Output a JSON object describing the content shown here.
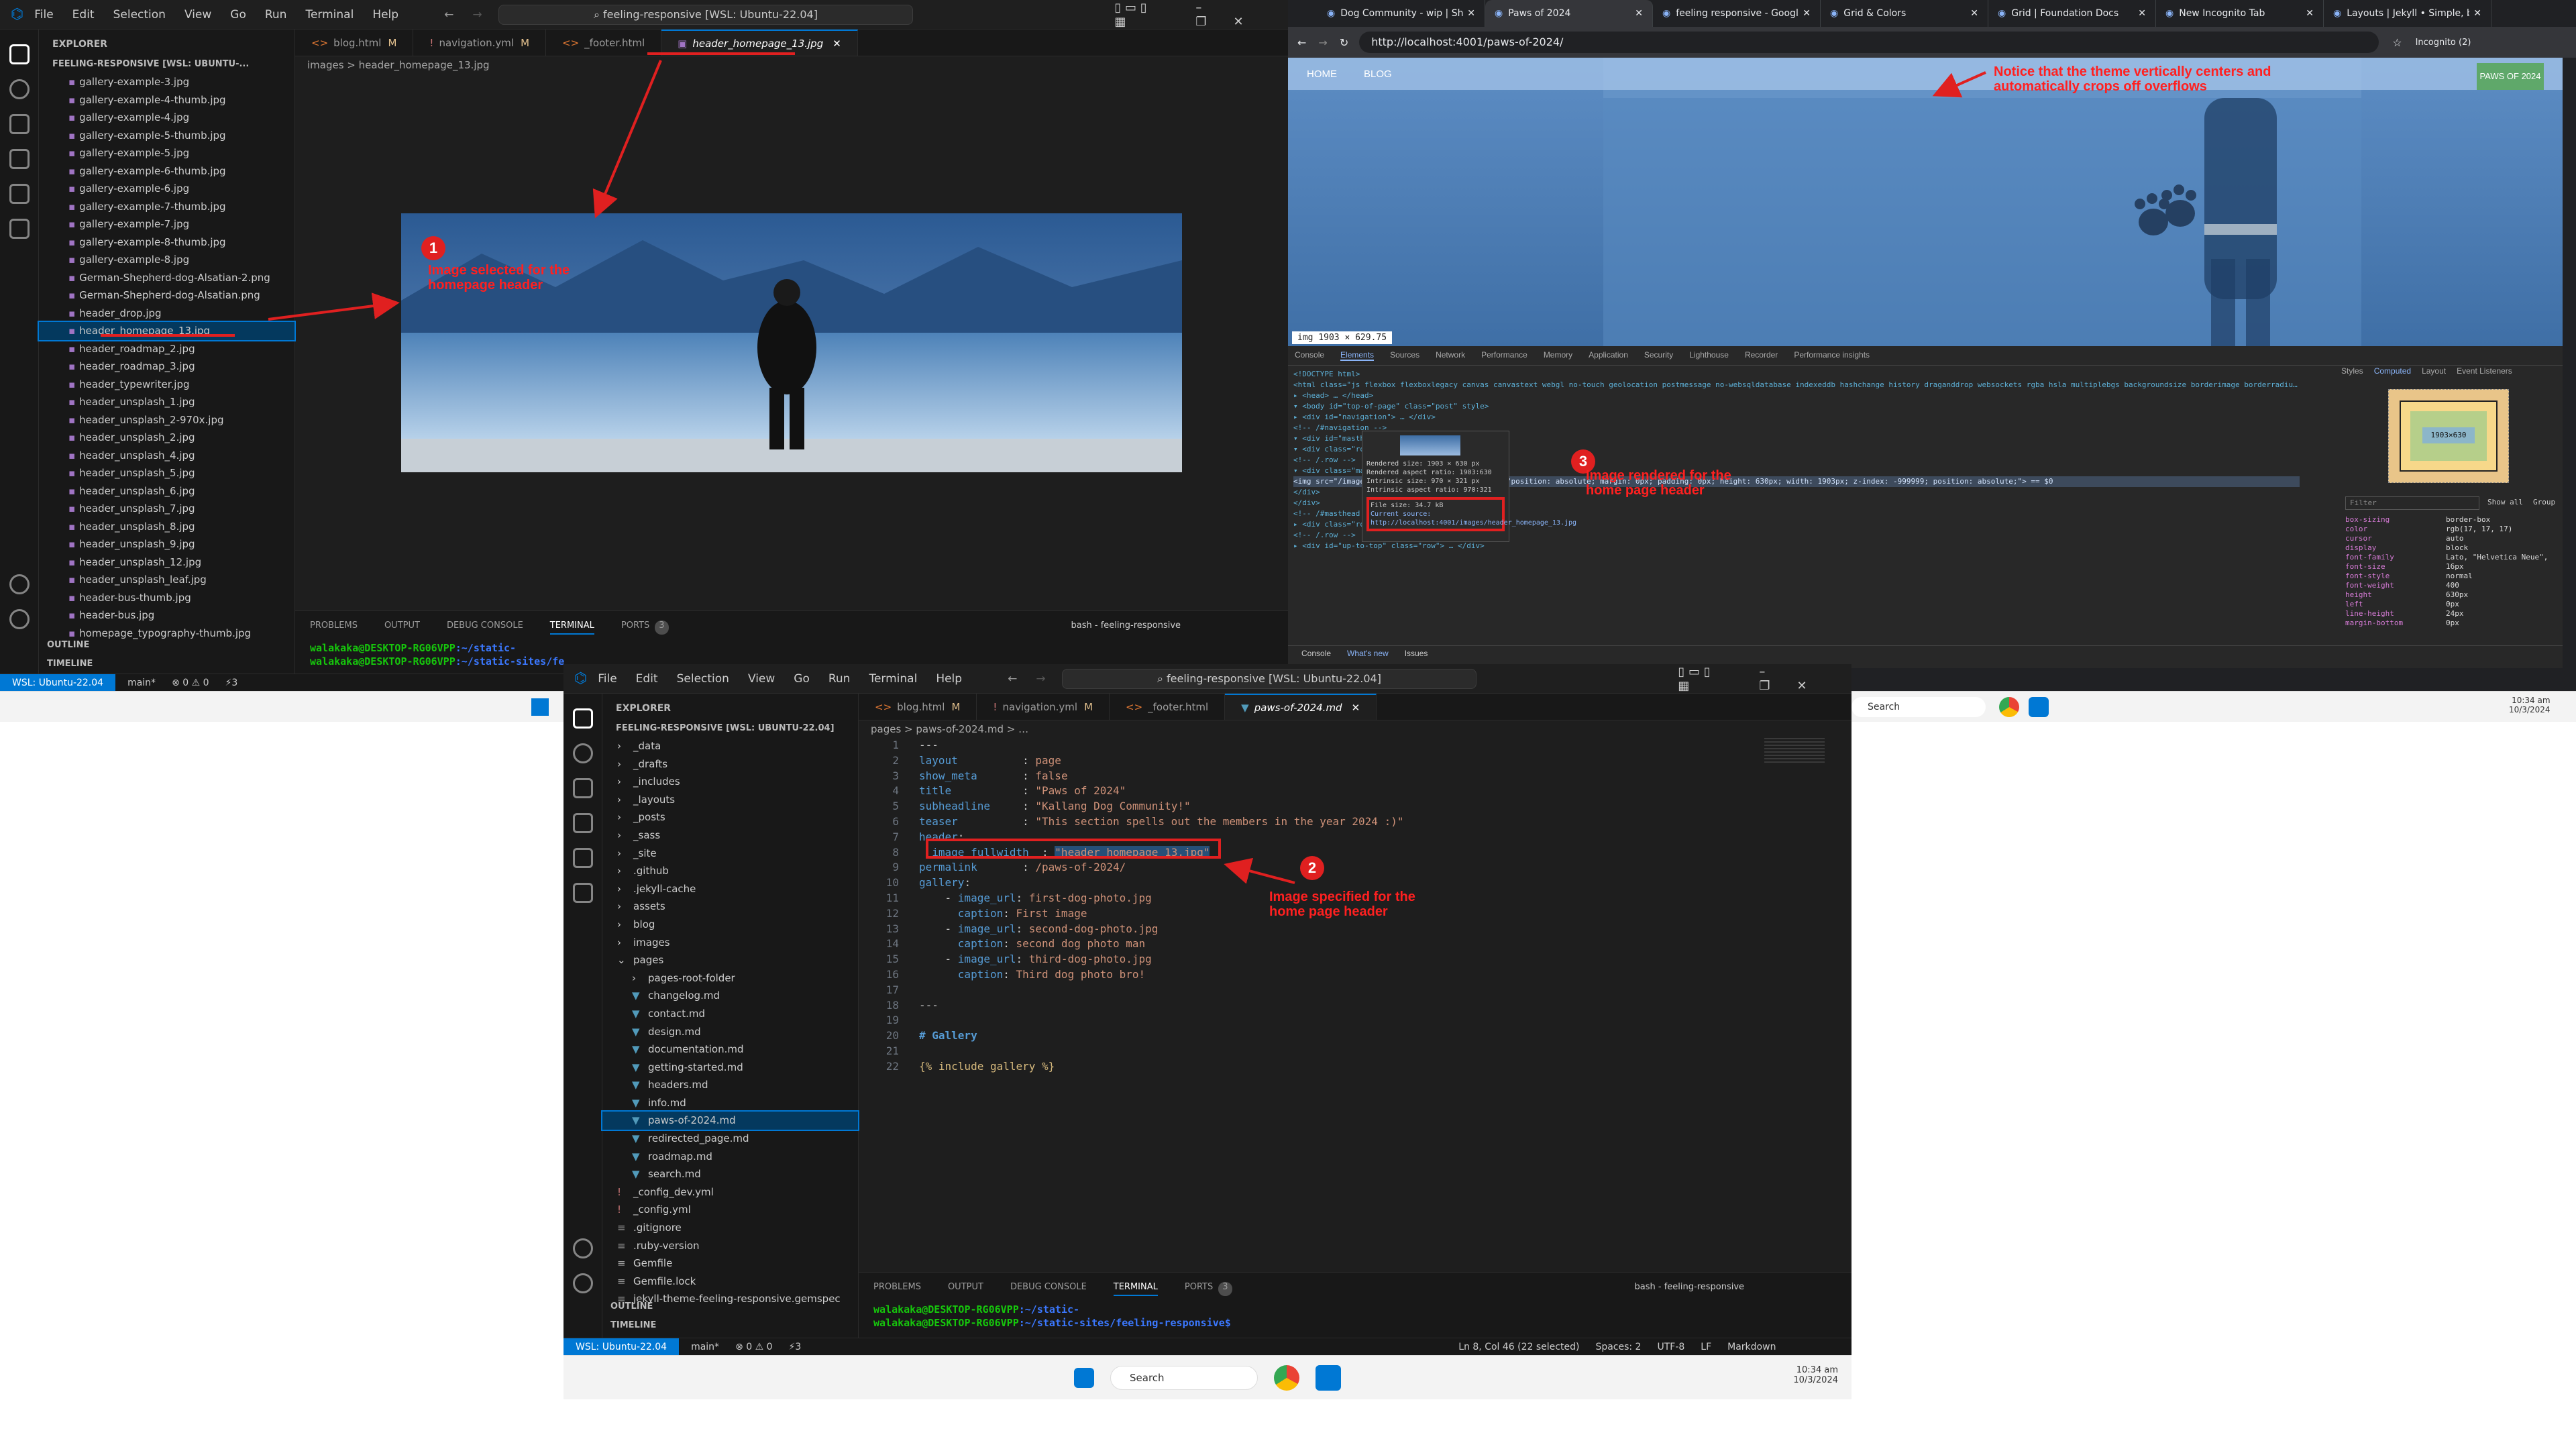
{
  "colors": {
    "accent": "#0078d4",
    "annotation": "#e02020",
    "sky": "#8fa7c7",
    "sea": "#5f8fbd",
    "page_header": "#4f7fb8"
  },
  "vscode_top": {
    "menu": [
      "File",
      "Edit",
      "Selection",
      "View",
      "Go",
      "Run",
      "Terminal",
      "Help"
    ],
    "command_center": "feeling-responsive [WSL: Ubuntu-22.04]",
    "explorer_title": "EXPLORER",
    "workspace": "FEELING-RESPONSIVE [WSL: UBUNTU-...",
    "files": [
      "gallery-example-3.jpg",
      "gallery-example-4-thumb.jpg",
      "gallery-example-4.jpg",
      "gallery-example-5-thumb.jpg",
      "gallery-example-5.jpg",
      "gallery-example-6-thumb.jpg",
      "gallery-example-6.jpg",
      "gallery-example-7-thumb.jpg",
      "gallery-example-7.jpg",
      "gallery-example-8-thumb.jpg",
      "gallery-example-8.jpg",
      "German-Shepherd-dog-Alsatian-2.png",
      "German-Shepherd-dog-Alsatian.png",
      "header_drop.jpg",
      "header_homepage_13.jpg",
      "header_roadmap_2.jpg",
      "header_roadmap_3.jpg",
      "header_typewriter.jpg",
      "header_unsplash_1.jpg",
      "header_unsplash_2-970x.jpg",
      "header_unsplash_2.jpg",
      "header_unsplash_4.jpg",
      "header_unsplash_5.jpg",
      "header_unsplash_6.jpg",
      "header_unsplash_7.jpg",
      "header_unsplash_8.jpg",
      "header_unsplash_9.jpg",
      "header_unsplash_12.jpg",
      "header_unsplash_leaf.jpg",
      "header-bus-thumb.jpg",
      "header-bus.jpg",
      "homepage_typography-thumb.jpg"
    ],
    "outline": "OUTLINE",
    "timeline": "TIMELINE",
    "tabs": [
      {
        "label": "blog.html",
        "mod": "M"
      },
      {
        "label": "navigation.yml",
        "mod": "M"
      },
      {
        "label": "_footer.html",
        "mod": ""
      },
      {
        "label": "header_homepage_13.jpg",
        "mod": ""
      }
    ],
    "breadcrumb": "images > header_homepage_13.jpg",
    "panel_tabs": [
      "PROBLEMS",
      "OUTPUT",
      "DEBUG CONSOLE",
      "TERMINAL",
      "PORTS"
    ],
    "ports_count": "3",
    "terminal_label": "bash - feeling-responsive",
    "terminal_lines": [
      {
        "user": "walakaka@DESKTOP-RG06VPP",
        "path": ":~/static-"
      },
      {
        "user": "walakaka@DESKTOP-RG06VPP",
        "path": ":~/static-sites/fe"
      }
    ],
    "status": {
      "remote": "WSL: Ubuntu-22.04",
      "branch": "main*",
      "problems": "⊗ 0 ⚠ 0",
      "ports": "⚡3"
    }
  },
  "annotations": {
    "one": {
      "num": "1",
      "text": "Image selected for the homepage header"
    },
    "two": {
      "num": "2",
      "text": "Image specified for the home page header"
    },
    "three": {
      "num": "3",
      "text": "Image rendered for the home page header"
    },
    "notice": "Notice that the theme vertically centers and automatically crops off overflows"
  },
  "browser": {
    "tabs": [
      "Dog Community - wip | Shaffo",
      "Paws of 2024",
      "feeling responsive - Google Se",
      "Grid & Colors",
      "Grid | Foundation Docs",
      "New Incognito Tab",
      "Layouts | Jekyll • Simple, blog"
    ],
    "url": "http://localhost:4001/paws-of-2024/",
    "incognito": "Incognito (2)",
    "nav": [
      "HOME",
      "BLOG"
    ],
    "page_badge": "PAWS OF 2024",
    "img_tooltip": "img 1903 × 629.75",
    "devtools_tabs": [
      "Console",
      "Elements",
      "Sources",
      "Network",
      "Performance",
      "Memory",
      "Application",
      "Security",
      "Lighthouse",
      "Recorder",
      "Performance insights"
    ],
    "styles_tabs": [
      "Styles",
      "Computed",
      "Layout",
      "Event Listeners"
    ],
    "info": {
      "rendered_size": "Rendered size: 1903 × 630 px",
      "rendered_ratio": "Rendered aspect ratio: 1903∶630",
      "intrinsic": "Intrinsic size: 970 × 321 px",
      "intrinsic_ratio": "Intrinsic aspect ratio: 970∶321",
      "file_size": "File size: 34.7 kB",
      "source": "Current source: http://localhost:4001/images/header_homepage_13.jpg"
    },
    "html_lines": [
      "<!DOCTYPE html>",
      "<html class=\"js flexbox flexboxlegacy canvas canvastext webgl no-touch geolocation postmessage no-websqldatabase indexeddb hashchange history draganddrop websockets rgba hsla multiplebgs backgroundsize borderimage borderradius boxshadow textshadow opacity cssanimations csscolumns cssgradients cssreflections csstransforms csstransforms3d csstransitions fontface generatedcontent video audio localstorage sessionstorage webworkers no-applicationcache svg inlinesvg smil svgclippaths\" lang=\"en\" style>",
      "▸ <head> … </head>",
      "▾ <body id=\"top-of-page\" class=\"post\" style>",
      "  ▸ <div id=\"navigation\"> … </div>",
      "  <!-- /#navigation -->",
      "  ▾ <div id=\"masthead\">",
      "    ▾ <div class=\"row\">",
      "      <!-- /.row -->",
      "    ▾ <div class=\"masthead-image\">",
      "      <img src=\"/images/header_homepage_13.jpg\" style=\"position: absolute; margin: 0px; padding: 0px; height: 630px; width: 1903px; z-index: -999999; position: absolute;\"> == $0",
      "    </div>",
      "  </div>",
      "  <!-- /#masthead -->",
      "  ▸ <div class=\"row t30\"> … </div>",
      "  <!-- /.row -->",
      "  ▸ <div id=\"up-to-top\" class=\"row\"> … </div>"
    ],
    "console_tabs": [
      "Console",
      "What's new",
      "Issues"
    ],
    "props": [
      {
        "k": "box-sizing",
        "v": "border-box"
      },
      {
        "k": "color",
        "v": "rgb(17, 17, 17)"
      },
      {
        "k": "cursor",
        "v": "auto"
      },
      {
        "k": "display",
        "v": "block"
      },
      {
        "k": "font-family",
        "v": "Lato, \"Helvetica Neue\","
      },
      {
        "k": "font-size",
        "v": "16px"
      },
      {
        "k": "font-style",
        "v": "normal"
      },
      {
        "k": "font-weight",
        "v": "400"
      },
      {
        "k": "height",
        "v": "630px"
      },
      {
        "k": "left",
        "v": "0px"
      },
      {
        "k": "line-height",
        "v": "24px"
      },
      {
        "k": "margin-bottom",
        "v": "0px"
      }
    ],
    "box_model": "1903×630",
    "filter_placeholder": "Filter",
    "show_all": "Show all",
    "group": "Group",
    "taskbar_search": "Search",
    "clock": "10:34 am",
    "date": "10/3/2024"
  },
  "vscode_bottom": {
    "menu": [
      "File",
      "Edit",
      "Selection",
      "View",
      "Go",
      "Run",
      "Terminal",
      "Help"
    ],
    "command_center": "feeling-responsive [WSL: Ubuntu-22.04]",
    "explorer_title": "EXPLORER",
    "workspace": "FEELING-RESPONSIVE [WSL: UBUNTU-22.04]",
    "tree": [
      {
        "label": "_data",
        "type": "dir",
        "depth": 0
      },
      {
        "label": "_drafts",
        "type": "dir",
        "depth": 0
      },
      {
        "label": "_includes",
        "type": "dir",
        "depth": 0
      },
      {
        "label": "_layouts",
        "type": "dir",
        "depth": 0
      },
      {
        "label": "_posts",
        "type": "dir",
        "depth": 0
      },
      {
        "label": "_sass",
        "type": "dir",
        "depth": 0
      },
      {
        "label": "_site",
        "type": "dir",
        "depth": 0
      },
      {
        "label": ".github",
        "type": "dir",
        "depth": 0
      },
      {
        "label": ".jekyll-cache",
        "type": "dir",
        "depth": 0
      },
      {
        "label": "assets",
        "type": "dir",
        "depth": 0
      },
      {
        "label": "blog",
        "type": "dir",
        "depth": 0
      },
      {
        "label": "images",
        "type": "dir",
        "depth": 0
      },
      {
        "label": "pages",
        "type": "open",
        "depth": 0
      },
      {
        "label": "pages-root-folder",
        "type": "dir",
        "depth": 1
      },
      {
        "label": "changelog.md",
        "type": "md",
        "depth": 1
      },
      {
        "label": "contact.md",
        "type": "md",
        "depth": 1
      },
      {
        "label": "design.md",
        "type": "md",
        "depth": 1
      },
      {
        "label": "documentation.md",
        "type": "md",
        "depth": 1
      },
      {
        "label": "getting-started.md",
        "type": "md",
        "depth": 1
      },
      {
        "label": "headers.md",
        "type": "md",
        "depth": 1
      },
      {
        "label": "info.md",
        "type": "md",
        "depth": 1
      },
      {
        "label": "paws-of-2024.md",
        "type": "md",
        "depth": 1,
        "sel": true
      },
      {
        "label": "redirected_page.md",
        "type": "md",
        "depth": 1
      },
      {
        "label": "roadmap.md",
        "type": "md",
        "depth": 1
      },
      {
        "label": "search.md",
        "type": "md",
        "depth": 1
      },
      {
        "label": "_config_dev.yml",
        "type": "yml",
        "depth": 0
      },
      {
        "label": "_config.yml",
        "type": "yml",
        "depth": 0
      },
      {
        "label": ".gitignore",
        "type": "file",
        "depth": 0
      },
      {
        "label": ".ruby-version",
        "type": "file",
        "depth": 0
      },
      {
        "label": "Gemfile",
        "type": "file",
        "depth": 0
      },
      {
        "label": "Gemfile.lock",
        "type": "file",
        "depth": 0
      },
      {
        "label": "jekyll-theme-feeling-responsive.gemspec",
        "type": "file",
        "depth": 0
      }
    ],
    "outline": "OUTLINE",
    "timeline": "TIMELINE",
    "tabs": [
      {
        "label": "blog.html",
        "mod": "M"
      },
      {
        "label": "navigation.yml",
        "mod": "M"
      },
      {
        "label": "_footer.html",
        "mod": ""
      },
      {
        "label": "paws-of-2024.md",
        "mod": ""
      }
    ],
    "breadcrumb": "pages > paws-of-2024.md > …",
    "code": [
      {
        "n": "1",
        "parts": [
          [
            "p",
            "---"
          ]
        ]
      },
      {
        "n": "2",
        "parts": [
          [
            "k",
            "layout"
          ],
          [
            "p",
            "          : "
          ],
          [
            "s",
            "page"
          ]
        ]
      },
      {
        "n": "3",
        "parts": [
          [
            "k",
            "show_meta"
          ],
          [
            "p",
            "       : "
          ],
          [
            "s",
            "false"
          ]
        ]
      },
      {
        "n": "4",
        "parts": [
          [
            "k",
            "title"
          ],
          [
            "p",
            "           : "
          ],
          [
            "s",
            "\"Paws of 2024\""
          ]
        ]
      },
      {
        "n": "5",
        "parts": [
          [
            "k",
            "subheadline"
          ],
          [
            "p",
            "     : "
          ],
          [
            "s",
            "\"Kallang Dog Community!\""
          ]
        ]
      },
      {
        "n": "6",
        "parts": [
          [
            "k",
            "teaser"
          ],
          [
            "p",
            "          : "
          ],
          [
            "s",
            "\"This section spells out the members in the year 2024 :)\""
          ]
        ]
      },
      {
        "n": "7",
        "parts": [
          [
            "k",
            "header"
          ],
          [
            "p",
            ":"
          ]
        ]
      },
      {
        "n": "8",
        "parts": [
          [
            "p",
            "  "
          ],
          [
            "k",
            "image_fullwidth"
          ],
          [
            "p",
            "  : "
          ],
          [
            "s",
            "\"header_homepage_13.jpg\""
          ]
        ]
      },
      {
        "n": "9",
        "parts": [
          [
            "k",
            "permalink"
          ],
          [
            "p",
            "       : "
          ],
          [
            "s",
            "/paws-of-2024/"
          ]
        ]
      },
      {
        "n": "10",
        "parts": [
          [
            "k",
            "gallery"
          ],
          [
            "p",
            ":"
          ]
        ]
      },
      {
        "n": "11",
        "parts": [
          [
            "p",
            "    - "
          ],
          [
            "k",
            "image_url"
          ],
          [
            "p",
            ": "
          ],
          [
            "s",
            "first-dog-photo.jpg"
          ]
        ]
      },
      {
        "n": "12",
        "parts": [
          [
            "p",
            "      "
          ],
          [
            "k",
            "caption"
          ],
          [
            "p",
            ": "
          ],
          [
            "s",
            "First image"
          ]
        ]
      },
      {
        "n": "13",
        "parts": [
          [
            "p",
            "    - "
          ],
          [
            "k",
            "image_url"
          ],
          [
            "p",
            ": "
          ],
          [
            "s",
            "second-dog-photo.jpg"
          ]
        ]
      },
      {
        "n": "14",
        "parts": [
          [
            "p",
            "      "
          ],
          [
            "k",
            "caption"
          ],
          [
            "p",
            ": "
          ],
          [
            "s",
            "second dog photo man"
          ]
        ]
      },
      {
        "n": "15",
        "parts": [
          [
            "p",
            "    - "
          ],
          [
            "k",
            "image_url"
          ],
          [
            "p",
            ": "
          ],
          [
            "s",
            "third-dog-photo.jpg"
          ]
        ]
      },
      {
        "n": "16",
        "parts": [
          [
            "p",
            "      "
          ],
          [
            "k",
            "caption"
          ],
          [
            "p",
            ": "
          ],
          [
            "s",
            "Third dog photo bro!"
          ]
        ]
      },
      {
        "n": "17",
        "parts": [
          [
            "p",
            ""
          ]
        ]
      },
      {
        "n": "18",
        "parts": [
          [
            "p",
            "---"
          ]
        ]
      },
      {
        "n": "19",
        "parts": [
          [
            "p",
            ""
          ]
        ]
      },
      {
        "n": "20",
        "parts": [
          [
            "h",
            "# Gallery"
          ]
        ]
      },
      {
        "n": "21",
        "parts": [
          [
            "p",
            ""
          ]
        ]
      },
      {
        "n": "22",
        "parts": [
          [
            "lq",
            "{% include gallery %}"
          ]
        ]
      }
    ],
    "panel_tabs": [
      "PROBLEMS",
      "OUTPUT",
      "DEBUG CONSOLE",
      "TERMINAL",
      "PORTS"
    ],
    "ports_count": "3",
    "terminal_label": "bash - feeling-responsive",
    "terminal_lines": [
      {
        "user": "walakaka@DESKTOP-RG06VPP",
        "path": ":~/static-"
      },
      {
        "user": "walakaka@DESKTOP-RG06VPP",
        "path": ":~/static-sites/feeling-responsive$"
      }
    ],
    "status": {
      "remote": "WSL: Ubuntu-22.04",
      "branch": "main*",
      "problems": "⊗ 0 ⚠ 0",
      "ports": "⚡3",
      "position": "Ln 8, Col 46 (22 selected)",
      "spaces": "Spaces: 2",
      "encoding": "UTF-8",
      "eol": "LF",
      "language": "Markdown"
    },
    "taskbar_search": "Search",
    "clock": "10:34 am",
    "date": "10/3/2024"
  }
}
